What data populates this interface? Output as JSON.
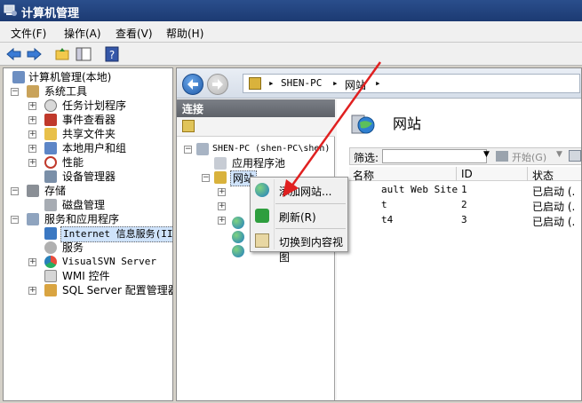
{
  "window": {
    "title": "计算机管理"
  },
  "menu": [
    {
      "label": "文件(F)"
    },
    {
      "label": "操作(A)"
    },
    {
      "label": "查看(V)"
    },
    {
      "label": "帮助(H)"
    }
  ],
  "left_tree": [
    {
      "label": "计算机管理(本地)",
      "icon": "computer-icon"
    },
    {
      "label": "系统工具",
      "icon": "tools-icon"
    },
    {
      "label": "任务计划程序",
      "icon": "clock-icon"
    },
    {
      "label": "事件查看器",
      "icon": "event-viewer-icon"
    },
    {
      "label": "共享文件夹",
      "icon": "shared-folder-icon"
    },
    {
      "label": "本地用户和组",
      "icon": "users-icon"
    },
    {
      "label": "性能",
      "icon": "performance-icon"
    },
    {
      "label": "设备管理器",
      "icon": "device-manager-icon"
    },
    {
      "label": "存储",
      "icon": "storage-icon"
    },
    {
      "label": "磁盘管理",
      "icon": "disk-icon"
    },
    {
      "label": "服务和应用程序",
      "icon": "services-apps-icon"
    },
    {
      "label": "Internet 信息服务(IIS",
      "icon": "iis-icon"
    },
    {
      "label": "服务",
      "icon": "gear-icon"
    },
    {
      "label": "VisualSVN Server",
      "icon": "svn-icon"
    },
    {
      "label": "WMI 控件",
      "icon": "wmi-icon"
    },
    {
      "label": "SQL Server 配置管理器",
      "icon": "sql-icon"
    }
  ],
  "address": {
    "segments": [
      "SHEN-PC",
      "网站"
    ]
  },
  "connections": {
    "header": "连接",
    "tree": [
      {
        "label": "SHEN-PC (shen-PC\\shen)"
      },
      {
        "label": "应用程序池"
      },
      {
        "label": "网站"
      }
    ]
  },
  "content": {
    "title": "网站",
    "filter_label": "筛选:",
    "start_label": "开始(G)",
    "columns": [
      "名称",
      "ID",
      "状态"
    ],
    "rows": [
      {
        "name": "ault Web Site",
        "id": "1",
        "status": "已启动 (."
      },
      {
        "name": "t",
        "id": "2",
        "status": "已启动 (."
      },
      {
        "name": "t4",
        "id": "3",
        "status": "已启动 (."
      }
    ]
  },
  "context_menu": [
    {
      "label": "添加网站...",
      "icon": "add-site-icon"
    },
    {
      "label": "刷新(R)",
      "icon": "refresh-icon"
    },
    {
      "label": "切换到内容视图",
      "icon": "content-view-icon"
    }
  ],
  "colors": {
    "accent": "#1c3a72",
    "annotation_arrow": "#e02020"
  }
}
